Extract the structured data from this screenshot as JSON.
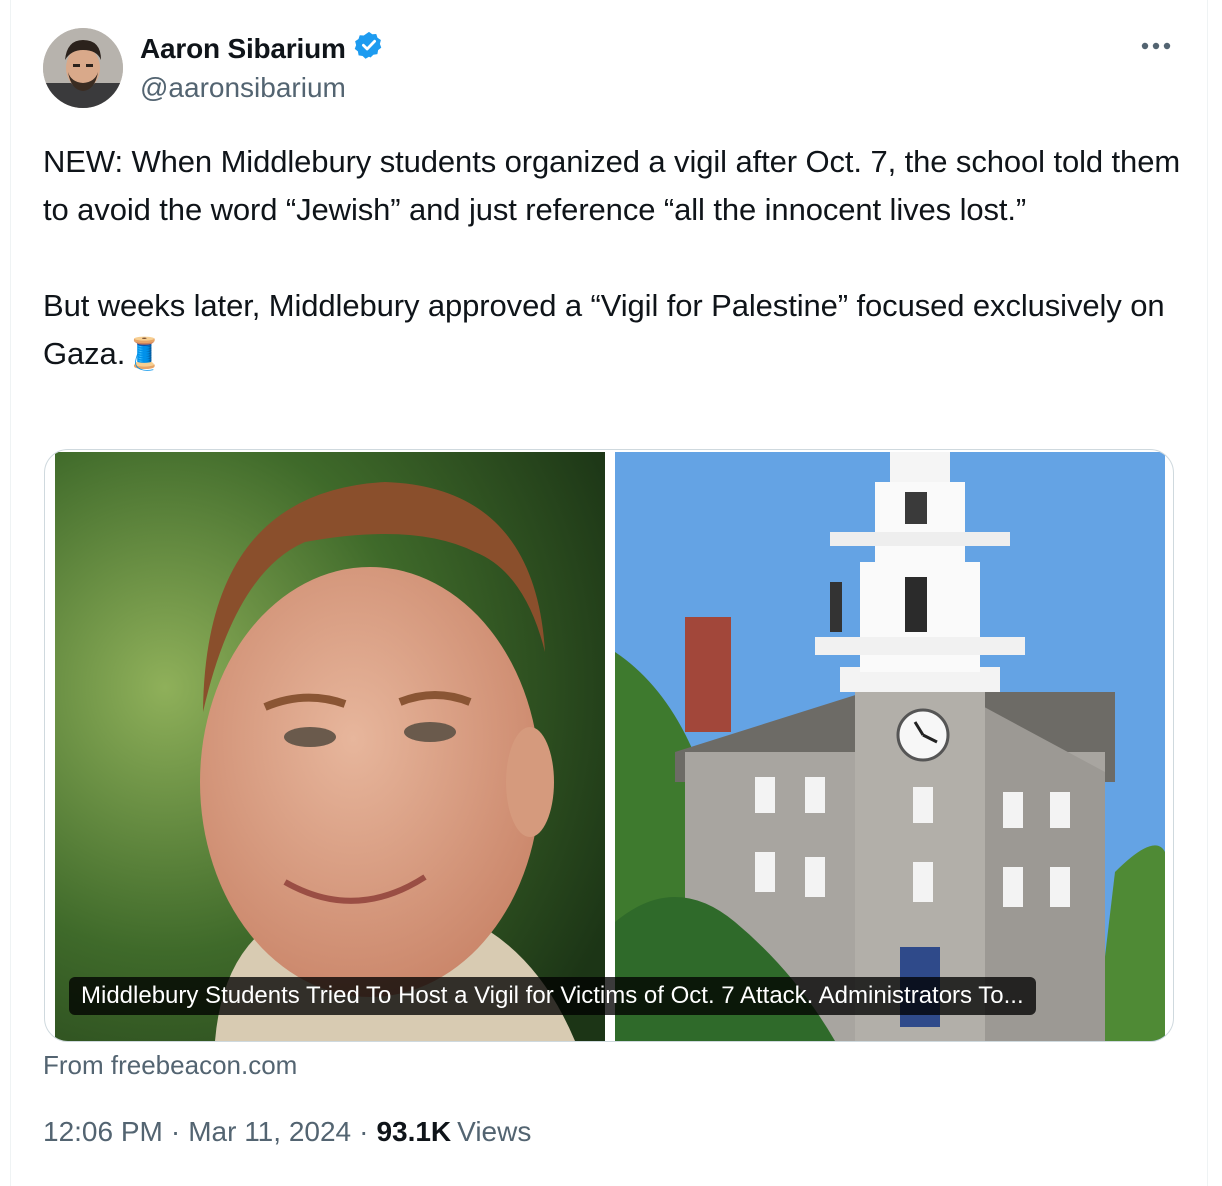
{
  "author": {
    "name": "Aaron Sibarium",
    "handle": "@aaronsibarium",
    "verified": true,
    "verified_icon": "verified-badge-icon",
    "verified_color": "#1d9bf0"
  },
  "more_icon": "more-dots-icon",
  "tweet": {
    "text": "NEW: When Middlebury students organized a vigil after Oct. 7, the school told them to avoid the word “Jewish” and just reference “all the innocent lives lost.”\n\nBut weeks later, Middlebury approved a “Vigil for Palestine” focused exclusively on Gaza.",
    "thread_emoji": "🧵"
  },
  "card": {
    "title": "Middlebury Students Tried To Host a Vigil for Victims of Oct. 7 Attack. Administrators To...",
    "source": "From freebeacon.com"
  },
  "meta": {
    "time": "12:06 PM",
    "date": "Mar 11, 2024",
    "views_count": "93.1K",
    "views_label": "Views",
    "separator": "·"
  }
}
